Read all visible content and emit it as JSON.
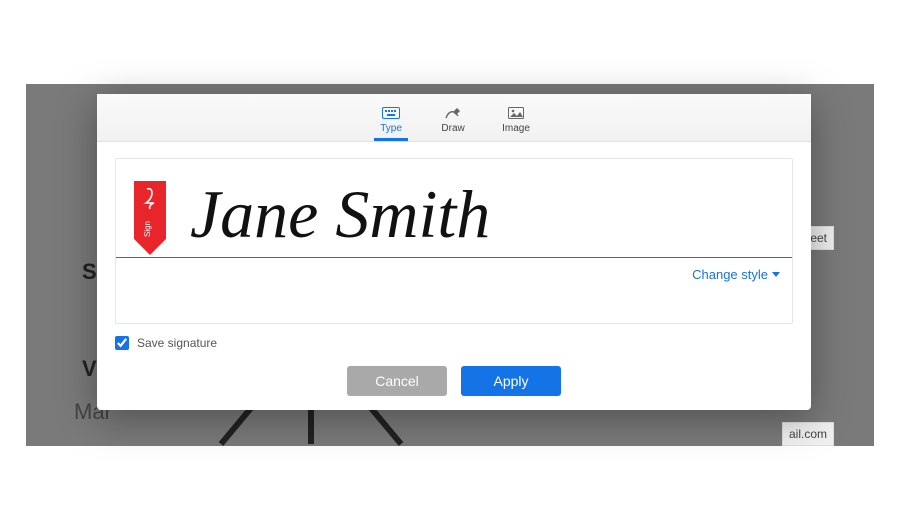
{
  "tabs": {
    "type": "Type",
    "draw": "Draw",
    "image": "Image"
  },
  "signature": {
    "text": "Jane Smith",
    "change_style": "Change style"
  },
  "save_checkbox": {
    "label": "Save signature",
    "checked": true
  },
  "buttons": {
    "cancel": "Cancel",
    "apply": "Apply"
  },
  "background": {
    "heading1": "Sigr",
    "heading2": "Visu",
    "heading3": "Mar",
    "field_right1": "treet",
    "field_right2": "ail.com"
  }
}
